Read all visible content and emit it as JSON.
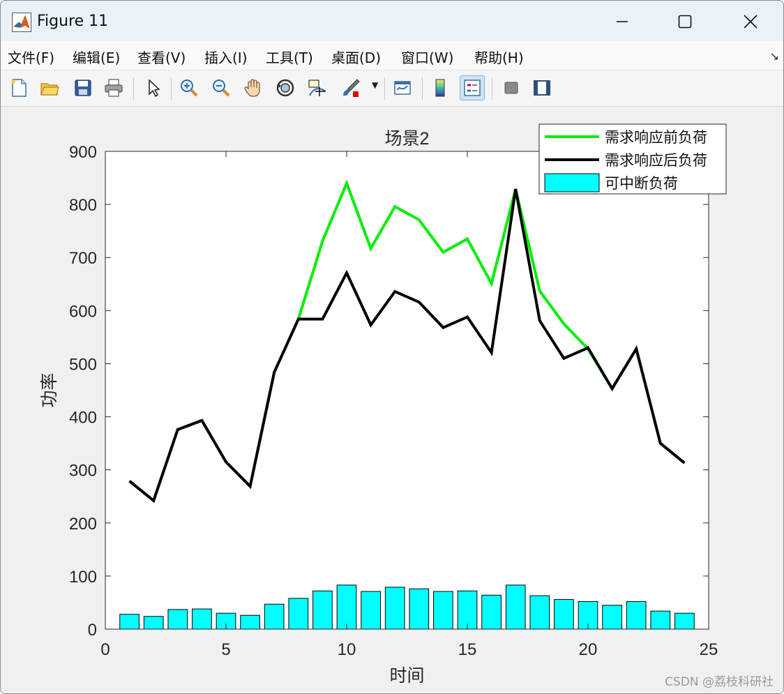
{
  "window": {
    "title": "Figure 11"
  },
  "menu": [
    {
      "label": "文件(F)",
      "name": "menu-file"
    },
    {
      "label": "编辑(E)",
      "name": "menu-edit"
    },
    {
      "label": "查看(V)",
      "name": "menu-view"
    },
    {
      "label": "插入(I)",
      "name": "menu-insert"
    },
    {
      "label": "工具(T)",
      "name": "menu-tools"
    },
    {
      "label": "桌面(D)",
      "name": "menu-desktop"
    },
    {
      "label": "窗口(W)",
      "name": "menu-window"
    },
    {
      "label": "帮助(H)",
      "name": "menu-help"
    }
  ],
  "toolbar": [
    {
      "icon": "new-figure-icon"
    },
    {
      "icon": "open-file-icon"
    },
    {
      "icon": "save-icon"
    },
    {
      "icon": "print-icon"
    },
    {
      "icon": "select-arrow-icon"
    },
    {
      "icon": "zoom-in-icon"
    },
    {
      "icon": "zoom-out-icon"
    },
    {
      "icon": "pan-hand-icon"
    },
    {
      "icon": "rotate-3d-icon"
    },
    {
      "icon": "data-cursor-icon"
    },
    {
      "icon": "brush-icon"
    },
    {
      "icon": "link-plot-icon"
    },
    {
      "icon": "colorbar-icon"
    },
    {
      "icon": "legend-icon"
    },
    {
      "icon": "hide-plot-tools-icon"
    },
    {
      "icon": "show-plot-tools-icon"
    }
  ],
  "chart_data": {
    "type": "line",
    "title": "场景2",
    "xlabel": "时间",
    "ylabel": "功率",
    "xlim": [
      0,
      25
    ],
    "ylim": [
      0,
      900
    ],
    "xticks": [
      0,
      5,
      10,
      15,
      20,
      25
    ],
    "yticks": [
      0,
      100,
      200,
      300,
      400,
      500,
      600,
      700,
      800,
      900
    ],
    "legend_position": "top-right",
    "x": [
      1,
      2,
      3,
      4,
      5,
      6,
      7,
      8,
      9,
      10,
      11,
      12,
      13,
      14,
      15,
      16,
      17,
      18,
      19,
      20,
      21,
      22,
      23,
      24
    ],
    "series": [
      {
        "name": "需求响应前负荷",
        "kind": "line",
        "color": "#00ee00",
        "values": [
          279,
          242,
          376,
          393,
          315,
          269,
          484,
          584,
          731,
          840,
          717,
          796,
          771,
          710,
          735,
          651,
          829,
          637,
          575,
          528,
          453,
          528,
          350,
          313
        ]
      },
      {
        "name": "需求响应后负荷",
        "kind": "line",
        "color": "#000000",
        "values": [
          279,
          242,
          376,
          393,
          315,
          269,
          484,
          584,
          584,
          671,
          573,
          636,
          616,
          568,
          588,
          521,
          829,
          581,
          510,
          530,
          453,
          528,
          350,
          313
        ]
      },
      {
        "name": "可中断负荷",
        "kind": "bar",
        "color": "#00ffff",
        "values": [
          28,
          24,
          37,
          38,
          30,
          26,
          47,
          58,
          72,
          83,
          71,
          79,
          76,
          71,
          72,
          64,
          83,
          63,
          56,
          52,
          45,
          52,
          34,
          30
        ]
      }
    ]
  },
  "watermark": "CSDN @荔枝科研社"
}
